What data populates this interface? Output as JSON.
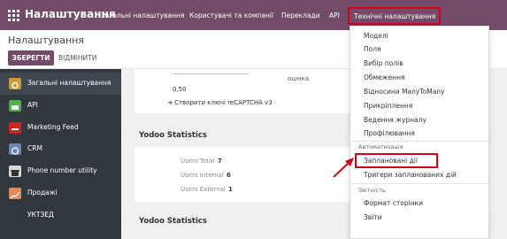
{
  "topbar": {
    "app_title": "Налаштування",
    "menu": [
      {
        "label": "Загальні налаштування"
      },
      {
        "label": "Користувачі та компанії"
      },
      {
        "label": "Переклади"
      },
      {
        "label": "API"
      },
      {
        "label": "Технічні налаштування"
      }
    ]
  },
  "control_panel": {
    "title": "Налаштування",
    "save_label": "ЗБЕРЕГТИ",
    "discard_label": "ВІДМІНИТИ"
  },
  "sidebar": {
    "items": [
      {
        "label": "Загальні налаштування",
        "icon": "settings-gear-icon",
        "color": "#c49a3a"
      },
      {
        "label": "API",
        "icon": "api-icon",
        "color": "#4caf50"
      },
      {
        "label": "Marketing Feed",
        "icon": "marketing-feed-icon",
        "color": "#c62828"
      },
      {
        "label": "CRM",
        "icon": "crm-icon",
        "color": "#6a86b8"
      },
      {
        "label": "Phone number utility",
        "icon": "phone-icon",
        "color": "#d9d9d9"
      },
      {
        "label": "Продажі",
        "icon": "sales-chart-icon",
        "color": "#e08a5a"
      },
      {
        "label": "УКТЗЕД",
        "icon": "",
        "color": ""
      }
    ]
  },
  "content": {
    "score_label": "оцінка",
    "score_value": "0,50",
    "recaptcha_link": "Створити ключі reCAPTCHA v3",
    "section1_title": "Yodoo Statistics",
    "stats": [
      {
        "label": "Users Total",
        "value": "7"
      },
      {
        "label": "Users Internal",
        "value": "6"
      },
      {
        "label": "Users External",
        "value": "1"
      }
    ],
    "section2_title": "Yodoo Statistics"
  },
  "dropdown": {
    "items_top": [
      "Моделі",
      "Поля",
      "Вибір полів",
      "Обмеження",
      "Відносини ManyToMany",
      "Прикріплення",
      "Ведення журналу",
      "Профілювання"
    ],
    "automation_header": "Автоматизація",
    "automation_items": [
      "Заплановані дії",
      "Тригери запланованих дій"
    ],
    "reports_header": "Звітність",
    "reports_items": [
      "Формат сторінки",
      "Звіти"
    ]
  },
  "colors": {
    "brand": "#714B67",
    "highlight": "#d0021b",
    "sidebar_bg": "#32373e"
  }
}
